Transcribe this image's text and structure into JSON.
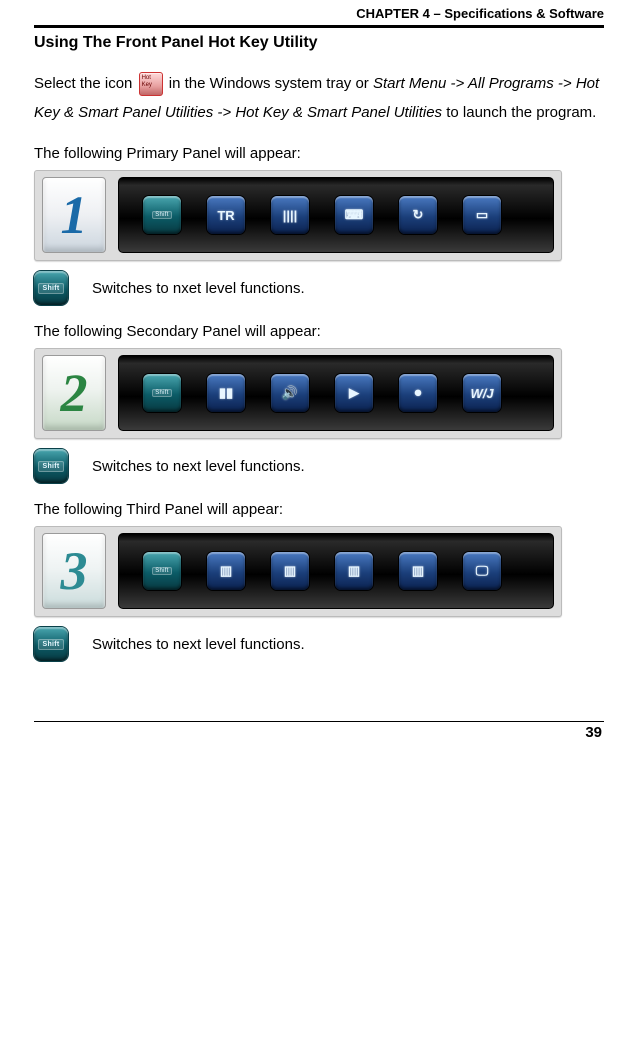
{
  "chapter_header": "CHAPTER 4 – Specifications & Software",
  "section_title": "Using The Front Panel Hot Key Utility",
  "intro": {
    "pre_icon": "Select the icon ",
    "post_icon": " in the Windows system tray or ",
    "menu_path": "Start Menu -> All Programs -> Hot Key & Smart Panel Utilities -> Hot Key & Smart Panel Utilities",
    "tail": " to launch the program."
  },
  "panel1": {
    "caption": "The following Primary Panel will appear:",
    "number": "1",
    "legend": "Switches to nxet level functions.",
    "buttons": [
      "shift",
      "tr",
      "barcode",
      "keyboard",
      "rotate",
      "display"
    ]
  },
  "panel2": {
    "caption": "The following Secondary Panel will appear:",
    "number": "2",
    "legend": "Switches to next level functions.",
    "buttons": [
      "shift",
      "pause",
      "speaker",
      "play",
      "record",
      "wj"
    ]
  },
  "panel3": {
    "caption": "The following Third Panel will appear:",
    "number": "3",
    "legend": "Switches to next level functions.",
    "buttons": [
      "shift",
      "app1",
      "app2",
      "app3",
      "app4",
      "monitor"
    ]
  },
  "page_number": "39",
  "icon_label_shift": "Shift"
}
